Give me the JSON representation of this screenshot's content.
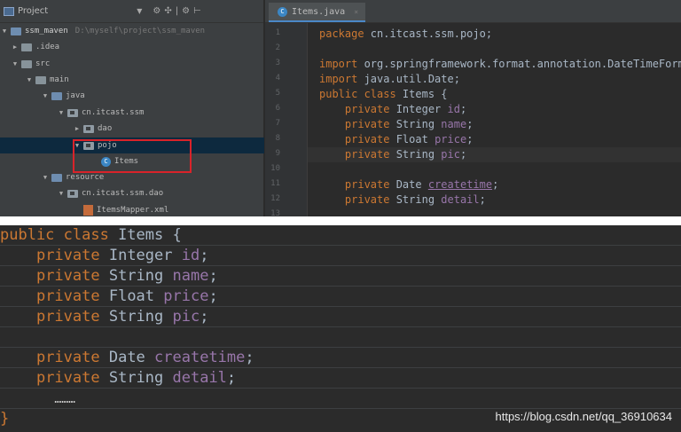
{
  "project_panel": {
    "title": "Project",
    "caret": "▼",
    "tools": [
      "⚙",
      "✣",
      "|",
      "⚙",
      "⊢"
    ],
    "tree": [
      {
        "label": "ssm_maven",
        "extra": "D:\\myself\\project\\ssm_maven",
        "toggle": "▼",
        "icon": "module-folder-icon"
      },
      {
        "label": ".idea",
        "toggle": "▶",
        "icon": "folder-icon"
      },
      {
        "label": "src",
        "toggle": "▼",
        "icon": "folder-icon"
      },
      {
        "label": "main",
        "toggle": "▼",
        "icon": "folder-icon"
      },
      {
        "label": "java",
        "toggle": "▼",
        "icon": "source-folder-icon"
      },
      {
        "label": "cn.itcast.ssm",
        "toggle": "▼",
        "icon": "package-icon"
      },
      {
        "label": "dao",
        "toggle": "▶",
        "icon": "package-icon"
      },
      {
        "label": "pojo",
        "toggle": "▼",
        "icon": "package-icon"
      },
      {
        "label": "Items",
        "toggle": "",
        "icon": "class-icon"
      },
      {
        "label": "resource",
        "toggle": "▼",
        "icon": "resource-folder-icon"
      },
      {
        "label": "cn.itcast.ssm.dao",
        "toggle": "▼",
        "icon": "package-icon"
      },
      {
        "label": "ItemsMapper.xml",
        "toggle": "",
        "icon": "xml-file-icon"
      }
    ]
  },
  "editor": {
    "tab_label": "Items.java",
    "tab_close": "×",
    "class_glyph": "C",
    "line_numbers": [
      "1",
      "2",
      "3",
      "4",
      "5",
      "6",
      "7",
      "8",
      "9",
      "10",
      "11",
      "12",
      "13"
    ],
    "lines": {
      "l1_kw": "package",
      "l1_rest": " cn.itcast.ssm.pojo;",
      "l3_kw": "import",
      "l3_rest": " org.springframework.format.annotation.DateTimeFormat;",
      "l4_kw": "import",
      "l4_rest": " java.util.Date;",
      "l5_kw": "public class",
      "l5_rest": " Items {",
      "l6_kw": "private",
      "l6_type": " Integer ",
      "l6_field": "id",
      "l6_end": ";",
      "l7_kw": "private",
      "l7_type": " String ",
      "l7_field": "name",
      "l7_end": ";",
      "l8_kw": "private",
      "l8_type": " Float ",
      "l8_field": "price",
      "l8_end": ";",
      "l9_kw": "private",
      "l9_type": " String ",
      "l9_field": "pic",
      "l9_end": ";",
      "l11_kw": "private",
      "l11_type": " Date ",
      "l11_field": "createtime",
      "l11_end": ";",
      "l12_kw": "private",
      "l12_type": " String ",
      "l12_field": "detail",
      "l12_end": ";"
    }
  },
  "snippet": {
    "s1_kw": "public class",
    "s1_rest": " Items {",
    "s2_kw": "private",
    "s2_type": " Integer ",
    "s2_field": "id",
    "s2_end": ";",
    "s3_kw": "private",
    "s3_type": " String ",
    "s3_field": "name",
    "s3_end": ";",
    "s4_kw": "private",
    "s4_type": " Float ",
    "s4_field": "price",
    "s4_end": ";",
    "s5_kw": "private",
    "s5_type": " String ",
    "s5_field": "pic",
    "s5_end": ";",
    "s7_kw": "private",
    "s7_type": " Date ",
    "s7_field": "createtime",
    "s7_end": ";",
    "s8_kw": "private",
    "s8_type": " String ",
    "s8_field": "detail",
    "s8_end": ";",
    "dots": "………",
    "closing": "}"
  },
  "watermark": "https://blog.csdn.net/qq_36910634",
  "colors": {
    "keyword": "#cc7832",
    "field": "#9876aa",
    "text": "#a9b7c6",
    "background": "#2b2b2b",
    "highlight_box": "#d9232a"
  }
}
